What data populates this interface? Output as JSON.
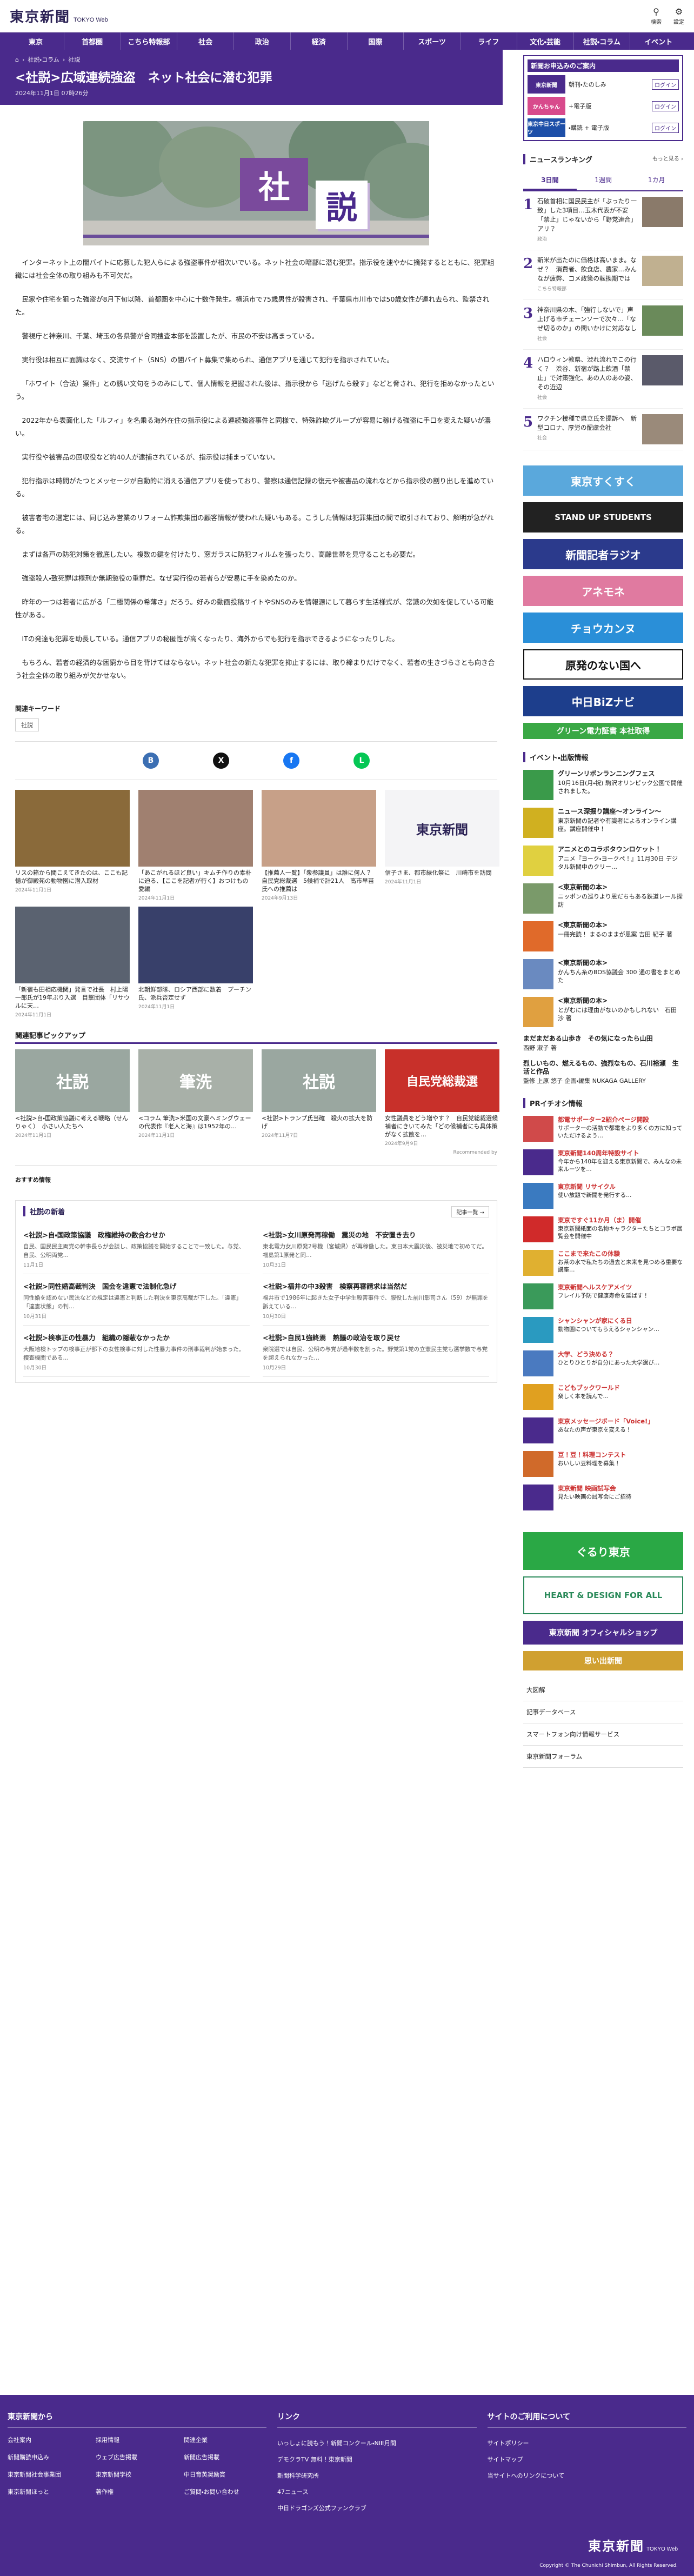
{
  "site": {
    "logo": "東京新聞",
    "logo_sub": "TOKYO Web",
    "search_label": "検索",
    "settings_label": "設定"
  },
  "nav": [
    "東京",
    "首都圏",
    "こちら特報部",
    "社会",
    "政治",
    "経済",
    "国際",
    "スポーツ",
    "ライフ",
    "文化・芸能",
    "社説・コラム",
    "イベント"
  ],
  "article": {
    "crumbs": [
      "社説・コラム",
      "社説"
    ],
    "title": "<社説>広域連続強盗　ネット社会に潜む犯罪",
    "date": "2024年11月1日 07時26分",
    "hero_k1": "社",
    "hero_k2": "説",
    "paras": [
      "インターネット上の闇バイトに応募した犯人らによる強盗事件が相次いでいる。ネット社会の暗部に潜む犯罪。指示役を速やかに摘発するとともに、犯罪組織には社会全体の取り組みも不可欠だ。",
      "民家や住宅を狙った強盗が8月下旬以降、首都圏を中心に十数件発生。横浜市で75歳男性が殺害され、千葉県市川市では50歳女性が連れ去られ、監禁された。",
      "警視庁と神奈川、千葉、埼玉の各県警が合同捜査本部を設置したが、市民の不安は高まっている。",
      "実行役は相互に面識はなく、交流サイト（SNS）の闇バイト募集で集められ、通信アプリを通じて犯行を指示されていた。",
      "「ホワイト（合法）案件」との誘い文句をうのみにして、個人情報を把握された後は、指示役から「逃げたら殺す」などと脅され、犯行を拒めなかったという。",
      "2022年から表面化した「ルフィ」を名乗る海外在住の指示役による連続強盗事件と同様で、特殊詐欺グループが容易に稼げる強盗に手口を変えた疑いが濃い。",
      "実行役や被害品の回収役など約40人が逮捕されているが、指示役は捕まっていない。",
      "犯行指示は時間がたつとメッセージが自動的に消える通信アプリを使っており、警察は通信記録の復元や被害品の流れなどから指示役の割り出しを進めている。",
      "被害者宅の選定には、同じ込み営業のリフォーム詐欺集団の顧客情報が使われた疑いもある。こうした情報は犯罪集団の間で取引されており、解明が急がれる。",
      "まずは各戸の防犯対策を徹底したい。複数の鍵を付けたり、窓ガラスに防犯フィルムを張ったり、高齢世帯を見守ることも必要だ。",
      "強盗殺人・致死罪は極刑か無期懲役の重罪だ。なぜ実行役の若者らが安易に手を染めたのか。",
      "昨年の一つは若者に広がる「二極関係の希薄さ」だろう。好みの動画投稿サイトやSNSのみを情報源にして暮らす生活様式が、常識の欠如を促している可能性がある。",
      "ITの発達も犯罪を助長している。通信アプリの秘匿性が高くなったり、海外からでも犯行を指示できるようになったりした。",
      "もちろん、若者の経済的な困窮から目を背けてはならない。ネット社会の新たな犯罪を抑止するには、取り締まりだけでなく、若者の生きづらさとも向き合う社会全体の取り組みが欠かせない。"
    ],
    "keywords_label": "関連キーワード",
    "keyword": "社説"
  },
  "share": {
    "icons": [
      "B",
      "X",
      "f",
      "L"
    ],
    "colors": [
      "#3c6fb3",
      "#111111",
      "#1877f2",
      "#06c755"
    ]
  },
  "related": [
    {
      "t": "リスの箱から聞こえてきたのは、ここも記憶が御殿苑の動物園に潜入取材",
      "d": "2024年11月1日"
    },
    {
      "t": "「あこがれるほど良い」キムチ作りの素朴に迫る、【ここを記者が行く】おつけもの愛編",
      "d": "2024年11月1日"
    },
    {
      "t": "【推薦人一覧】「衆参議員」は誰に何人？自民党総裁選　5候補で計21人　高市早苗氏への推薦は",
      "d": "2024年9月13日"
    },
    {
      "t": "信子さま、都市緑化祭に　川崎市を訪問",
      "d": "2024年11月1日"
    },
    {
      "t": "「新宿も田相応機関」発言で社長　村上陽一郎氏が19年ぶり入選　目撃団体「リサウルに天…",
      "d": "2024年11月1日"
    },
    {
      "t": "北朝鮮部隊、ロシア西部に数着　プーチン氏、派兵否定せず",
      "d": "2024年11月1日"
    }
  ],
  "pickup": {
    "title": "関連記事ピックアップ",
    "items": [
      {
        "t": "<社説>自・国政策協議に考える戦略（せんりゃく）　小さい人たちへ",
        "d": "2024年11月1日",
        "k": "社説"
      },
      {
        "t": "<コラム 筆洗>米国の文豪ヘミングウェーの代表作『老人と海』は1952年の…",
        "d": "2024年11月1日",
        "k": "筆洗"
      },
      {
        "t": "<社説>トランプ氏当確　殺火の拡大を防げ",
        "d": "2024年11月7日",
        "k": "社説"
      },
      {
        "t": "女性議員をどう増やす？　自民党総裁選候補者にきいてみた「どの候補者にも具体策がなく拡散を…",
        "d": "2024年9月9日",
        "k": "自民党総裁選"
      }
    ],
    "rec_label": "Recommended by",
    "osusume": "おすすめ情報"
  },
  "shasetsu": {
    "title": "社説の新着",
    "more": "記事一覧 →",
    "items": [
      {
        "h": "<社説>自・国政策協議　政権維持の数合わせか",
        "s": "自民、国民民主両党の幹事長らが会談し、政策協議を開始することで一致した。与党、自民、公明両党…",
        "d": "11月1日"
      },
      {
        "h": "<社説>女川原発再稼働　震災の地　不安置き去り",
        "s": "東北電力女川原発2号機（宮城県）が再稼働した。東日本大震災後、被災地で初めてだ。福島第1原発と同…",
        "d": "10月31日"
      },
      {
        "h": "<社説>同性婚高裁判決　国会を違憲で法制化急げ",
        "s": "同性婚を認めない民法などの規定は違憲と判断した判決を東京高裁が下した。「違憲」「違憲状態」の判…",
        "d": "10月31日"
      },
      {
        "h": "<社説>福井の中3殺害　検察再審請求は当然だ",
        "s": "福井市で1986年に起きた女子中学生殺害事件で、服役した前川彰司さん（59）が無罪を訴えている…",
        "d": "10月30日"
      },
      {
        "h": "<社説>検事正の性暴力　組織の隠蔽なかったか",
        "s": "大阪地検トップの検事正が部下の女性検事に対した性暴力事件の刑事裁判が始まった。捜査機関である…",
        "d": "10月30日"
      },
      {
        "h": "<社説>自民1強終焉　熟議の政治を取り戻せ",
        "s": "衆院選では自民、公明の与党が過半数を割った。野党第1党の立憲民主党も選挙数で与党を超えられなかった…",
        "d": "10月29日"
      }
    ]
  },
  "sidebar": {
    "promo_title": "新聞お申込みのご案内",
    "promo_rows": [
      {
        "logo": "東京新聞",
        "text": "朝刊・たのしみ",
        "btn": "ログイン",
        "color": "#4a2a8c"
      },
      {
        "logo": "かんちゃん",
        "text": "+電子版",
        "btn": "ログイン",
        "color": "#d84a8c"
      },
      {
        "logo": "東京中日スポーツ",
        "text": "・購読 + 電子版",
        "btn": "ログイン",
        "color": "#1d4fa8"
      }
    ],
    "ranking_title": "ニュースランキング",
    "ranking_more": "もっと見る ›",
    "tabs": [
      "3日間",
      "1週間",
      "1カ月"
    ],
    "ranking": [
      {
        "n": "1",
        "t": "石破首相に国民民主が「ぶったり一致」した3項目…玉木代表が不安「禁止」じゃないから「野党連合」アリ？",
        "c": "政治"
      },
      {
        "n": "2",
        "t": "新米が出たのに価格は高いまま。なぜ？　消費者、飲食店、農家…みんなが疲弊、コメ政策の転換期では",
        "c": "こちら特報部"
      },
      {
        "n": "3",
        "t": "神奈川県の木、「強行しないで」声上げる市チェーンソーで次々…「なぜ切るのか」の問いかけに対応なし",
        "c": "社会"
      },
      {
        "n": "4",
        "t": "ハロウィン教県、渋れ流れでこの行く？　渋谷、新宿が路上飲酒「禁止」で対策強化、あの人のあの姿、その近辺",
        "c": "社会"
      },
      {
        "n": "5",
        "t": "ワクチン接種で県立氏を提訴へ　新型コロナ、厚労の配慮会社",
        "c": "社会"
      }
    ],
    "banners": [
      {
        "t": "東京すくすく",
        "c": "#5aa8dc"
      },
      {
        "t": "STAND UP STUDENTS",
        "c": "#222222"
      },
      {
        "t": "新聞記者ラジオ",
        "c": "#2b3a8c"
      },
      {
        "t": "アネモネ",
        "c": "#e07aa0"
      },
      {
        "t": "チョウカンヌ",
        "c": "#2a8fd8"
      },
      {
        "t": "原発のない国へ",
        "c": "#ffffff"
      },
      {
        "t": "中日BiZナビ",
        "c": "#1d3e8c"
      },
      {
        "t": "グリーン電力証書 本社取得",
        "c": "#3aa845"
      }
    ],
    "events_title": "イベント・出版情報",
    "events": [
      {
        "b": "グリーンリボンランニングフェス",
        "t": "10月16日(月・祝) 駒沢オリンピック公園で開催されました。",
        "c": "#3a9a4a"
      },
      {
        "b": "ニュース深掘り講座〜オンライン〜",
        "t": "東京新聞の記者や有識者によるオンライン講座。講座開催中！",
        "c": "#d0b020"
      },
      {
        "b": "アニメとのコラボタウンロケット！",
        "t": "アニメ『ヨーク・ヨークペ！』11月30日 デジタル新聞中のクリー…",
        "c": "#e0d040"
      },
      {
        "b": "<東京新聞の本>",
        "t": "ニッポンの巡りより恩だちもある鉄道レール探訪",
        "c": "#7a9a6a"
      },
      {
        "b": "<東京新聞の本>",
        "t": "一冊完読！ まるのままが思案 吉田 紀子 著",
        "c": "#e06a2a"
      },
      {
        "b": "<東京新聞の本>",
        "t": "かんちん糸のBOS協議会 300 通の書をまとめた",
        "c": "#6a8ac0"
      },
      {
        "b": "<東京新聞の本>",
        "t": "とがむには理由がないのかもしれない　石田 沙 著",
        "c": "#e0a040"
      },
      {
        "b": "まだまだある山歩き　その気になったら山田",
        "t": "西野 淑子 著",
        "c": "#ffffff"
      },
      {
        "b": "烈しいもの、燃えるもの、強烈なもの、石川裕瀬　生活と作品",
        "t": "監修 上原 悠子 企画・編集 NUKAGA GALLERY",
        "c": "#ffffff"
      }
    ],
    "pr_title": "PRイチオシ情報",
    "pr": [
      {
        "b": "都電サポーター2紹介ページ開設",
        "t": "サポーターの活動で都電をより多くの方に知っていただけるよう…",
        "c": "#d04a4a"
      },
      {
        "b": "東京新聞140周年特設サイト",
        "t": "今年から140年を迎える東京新聞で、みんなの未来ルーツを…",
        "c": "#4a2a8c"
      },
      {
        "b": "東京新聞 リサイクル",
        "t": "使い放題で新聞を発行する…",
        "c": "#3a7ac0"
      },
      {
        "b": "東京ですぐ11か月（ま）開催",
        "t": "東京新聞紙面の名物キャラクターたちとコラボ展覧会を開催中",
        "c": "#d02a2a"
      },
      {
        "b": "ここまで来たこの体験",
        "t": "お茶の水で私たちの過去と未来を見つめる重要な講座…",
        "c": "#e0b030"
      },
      {
        "b": "東京新聞ヘルスケアメイツ",
        "t": "フレイル予防で健康寿命を延ばす！",
        "c": "#3a9a5a"
      },
      {
        "b": "シャンシャンが家にくる日",
        "t": "動物園についてもらえるシャンシャン…",
        "c": "#2a9ac0"
      },
      {
        "b": "大学、どう決める？",
        "t": "ひとりひとりが自分にあった大学選び…",
        "c": "#4a7ac0"
      },
      {
        "b": "こどもブックワールド",
        "t": "楽しく本を読んで…",
        "c": "#e0a020"
      },
      {
        "b": "東京メッセージボード「Voice!」",
        "t": "あなたの声が東京を変える！",
        "c": "#4a2a8c"
      },
      {
        "b": "豆！豆！料理コンテスト",
        "t": "おいしい豆料理を募集！",
        "c": "#d06a2a"
      },
      {
        "b": "東京新聞 映画試写会",
        "t": "見たい映画の試写会にご招待",
        "c": "#4a2a8c"
      }
    ],
    "banners2": [
      {
        "t": "ぐるり東京",
        "c": "#2aa845"
      },
      {
        "t": "HEART & DESIGN FOR ALL",
        "c": "#ffffff"
      },
      {
        "t": "東京新聞 オフィシャルショップ",
        "c": "#4a2a8c"
      },
      {
        "t": "思い出新聞",
        "c": "#d0a030"
      }
    ],
    "links": [
      "大図解",
      "記事データベース",
      "スマートフォン向け情報サービス",
      "東京新聞フォーラム"
    ]
  },
  "footer": {
    "col1_title": "東京新聞から",
    "col1": [
      "会社案内",
      "採用情報",
      "関連企業",
      "新聞購読申込み",
      "ウェブ広告掲載",
      "新聞広告掲載",
      "東京新聞社会事業団",
      "東京新聞学校",
      "中日育英奨励賞",
      "東京新聞ほっと",
      "著作権",
      "ご質問・お問い合わせ"
    ],
    "col2_title": "リンク",
    "col2": [
      "いっしょに読もう！新聞コンクール・NIE月間",
      "デモクラTV 無料！東京新聞",
      "新聞科学研究所",
      "47ニュース",
      "中日ドラゴンズ公式ファンクラブ"
    ],
    "col3_title": "サイトのご利用について",
    "col3": [
      "サイトポリシー",
      "サイトマップ",
      "当サイトへのリンクについて"
    ],
    "logo": "東京新聞",
    "logo_sub": "TOKYO Web",
    "copyright": "Copyright © The Chunichi Shimbun, All Rights Reserved."
  }
}
